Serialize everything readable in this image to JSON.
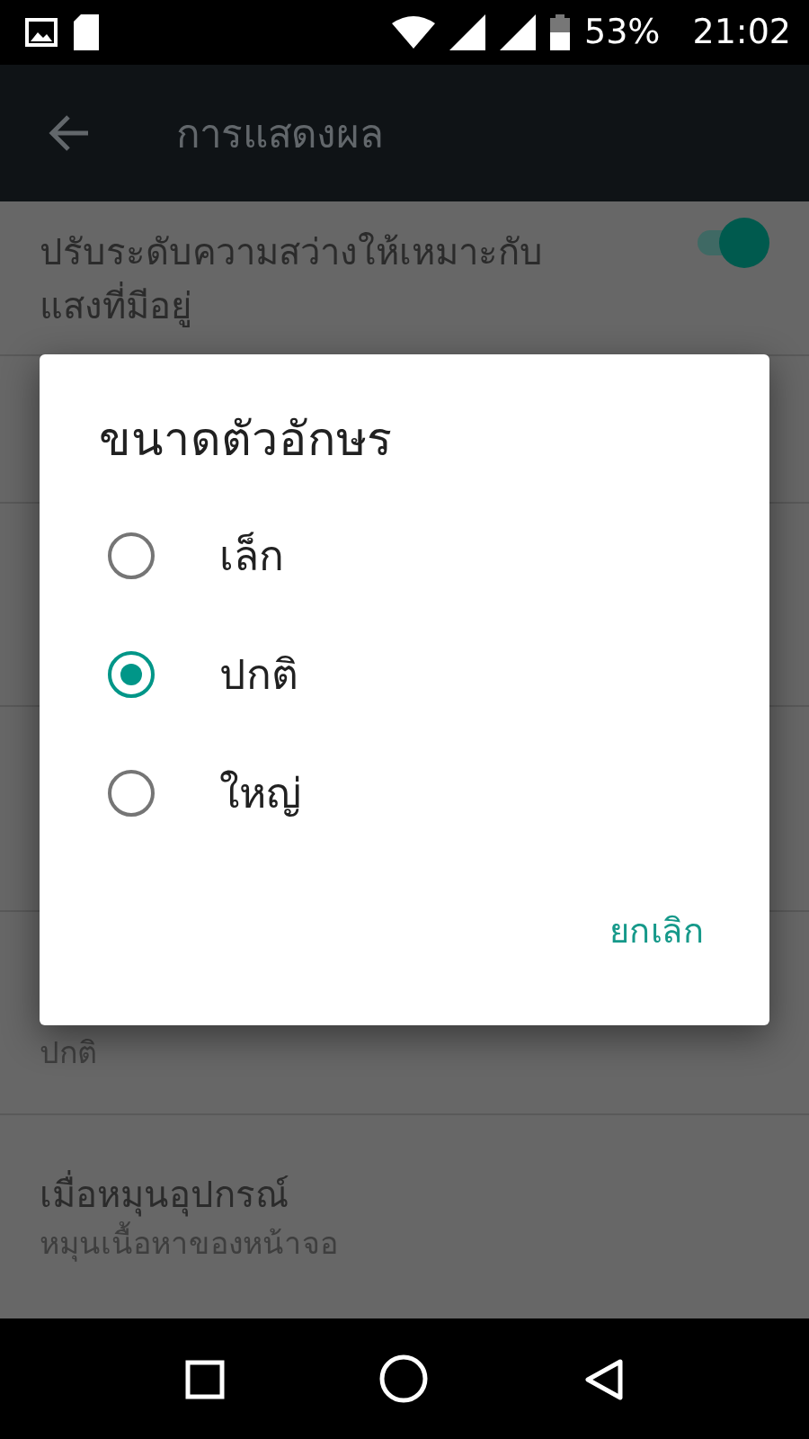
{
  "status_bar": {
    "battery": "53%",
    "time": "21:02"
  },
  "app_bar": {
    "title": "การแสดงผล"
  },
  "settings": [
    {
      "kind": "switch",
      "title": "ปรับระดับความสว่างให้เหมาะกับแสงที่มีอยู่",
      "on": true
    },
    {
      "kind": "hidden"
    },
    {
      "kind": "hidden"
    },
    {
      "kind": "hidden"
    },
    {
      "kind": "summary_only",
      "summary": "ปกติ"
    },
    {
      "kind": "item",
      "title": "เมื่อหมุนอุปกรณ์",
      "summary": "หมุนเนื้อหาของหน้าจอ"
    }
  ],
  "dialog": {
    "title": "ขนาดตัวอักษร",
    "options": [
      {
        "label": "เล็ก",
        "selected": false
      },
      {
        "label": "ปกติ",
        "selected": true
      },
      {
        "label": "ใหญ่",
        "selected": false
      }
    ],
    "buttons": [
      "ยกเลิก"
    ]
  }
}
